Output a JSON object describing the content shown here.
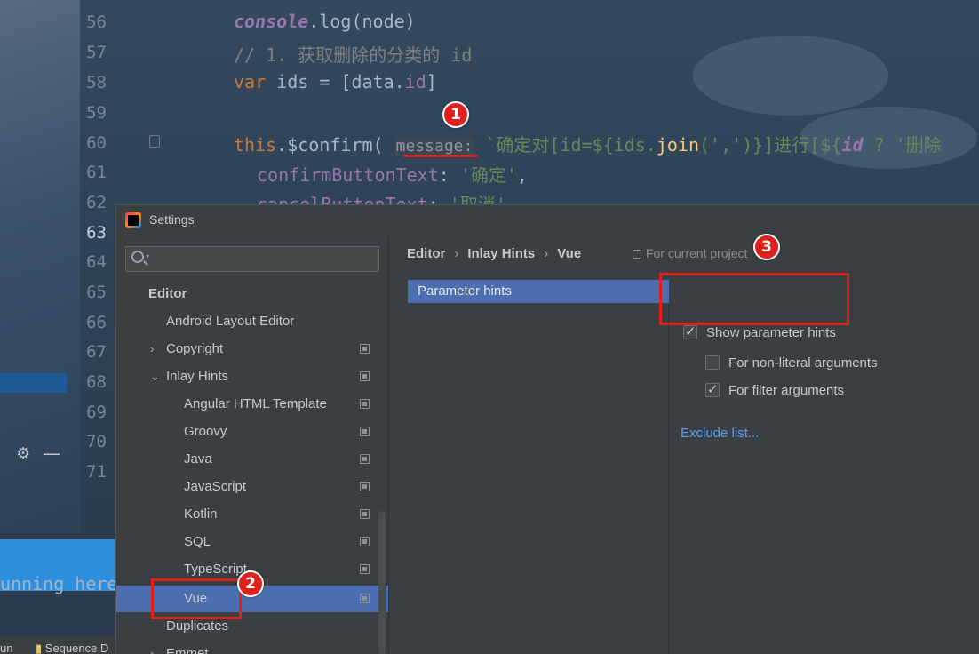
{
  "editor": {
    "line_numbers": [
      "56",
      "57",
      "58",
      "59",
      "60",
      "61",
      "62",
      "63",
      "64",
      "65",
      "66",
      "67",
      "68",
      "69",
      "70",
      "71"
    ],
    "current_line": "63",
    "code": {
      "l56_a": "console",
      "l56_b": ".log(node)",
      "l57": "// 1. 获取删除的分类的 id",
      "l58_kw": "var",
      "l58_b": " ids = [data.",
      "l58_c": "id",
      "l58_d": "]",
      "l60_kw": "this",
      "l60_b": ".$confirm(",
      "l60_inlay": "message:",
      "l60_c": "`确定对[id=${ids.",
      "l60_fn": "join",
      "l60_d": "(',')}]进行[${",
      "l60_e": "id",
      "l60_f": " ? '删除",
      "l61_a": "confirmButtonText",
      "l61_b": ": ",
      "l61_c": "'确定'",
      "l61_d": ",",
      "l62_a": "cancelButtonText",
      "l62_b": ": ",
      "l62_c": "'取消'"
    },
    "run_text": "unning here",
    "bottom_tabs": [
      "un",
      "Sequence D"
    ]
  },
  "dialog": {
    "title": "Settings",
    "search": {
      "value": "",
      "placeholder": ""
    },
    "tree": {
      "section": "Editor",
      "items": [
        {
          "label": "Android Layout Editor"
        },
        {
          "label": "Copyright"
        },
        {
          "label": "Inlay Hints"
        },
        {
          "label": "Angular HTML Template"
        },
        {
          "label": "Groovy"
        },
        {
          "label": "Java"
        },
        {
          "label": "JavaScript"
        },
        {
          "label": "Kotlin"
        },
        {
          "label": "SQL"
        },
        {
          "label": "TypeScript"
        },
        {
          "label": "Vue"
        },
        {
          "label": "Duplicates"
        },
        {
          "label": "Emmet"
        }
      ],
      "selected": "Vue"
    },
    "breadcrumb": [
      "Editor",
      "Inlay Hints",
      "Vue"
    ],
    "breadcrumb_sep": "›",
    "scope_label": "For current project",
    "languages": [
      "Parameter hints"
    ],
    "options": {
      "show_parameter_hints": {
        "label": "Show parameter hints",
        "checked": true
      },
      "non_literal": {
        "label": "For non-literal arguments",
        "checked": false
      },
      "filter_arguments": {
        "label": "For filter arguments",
        "checked": true
      }
    },
    "exclude_link": "Exclude list..."
  },
  "annotations": {
    "markers": [
      "1",
      "2",
      "3"
    ],
    "color": "#e0201c"
  },
  "colors": {
    "selection": "#4b6eaf",
    "link": "#589df6",
    "dialog_bg": "#3c3f41"
  }
}
